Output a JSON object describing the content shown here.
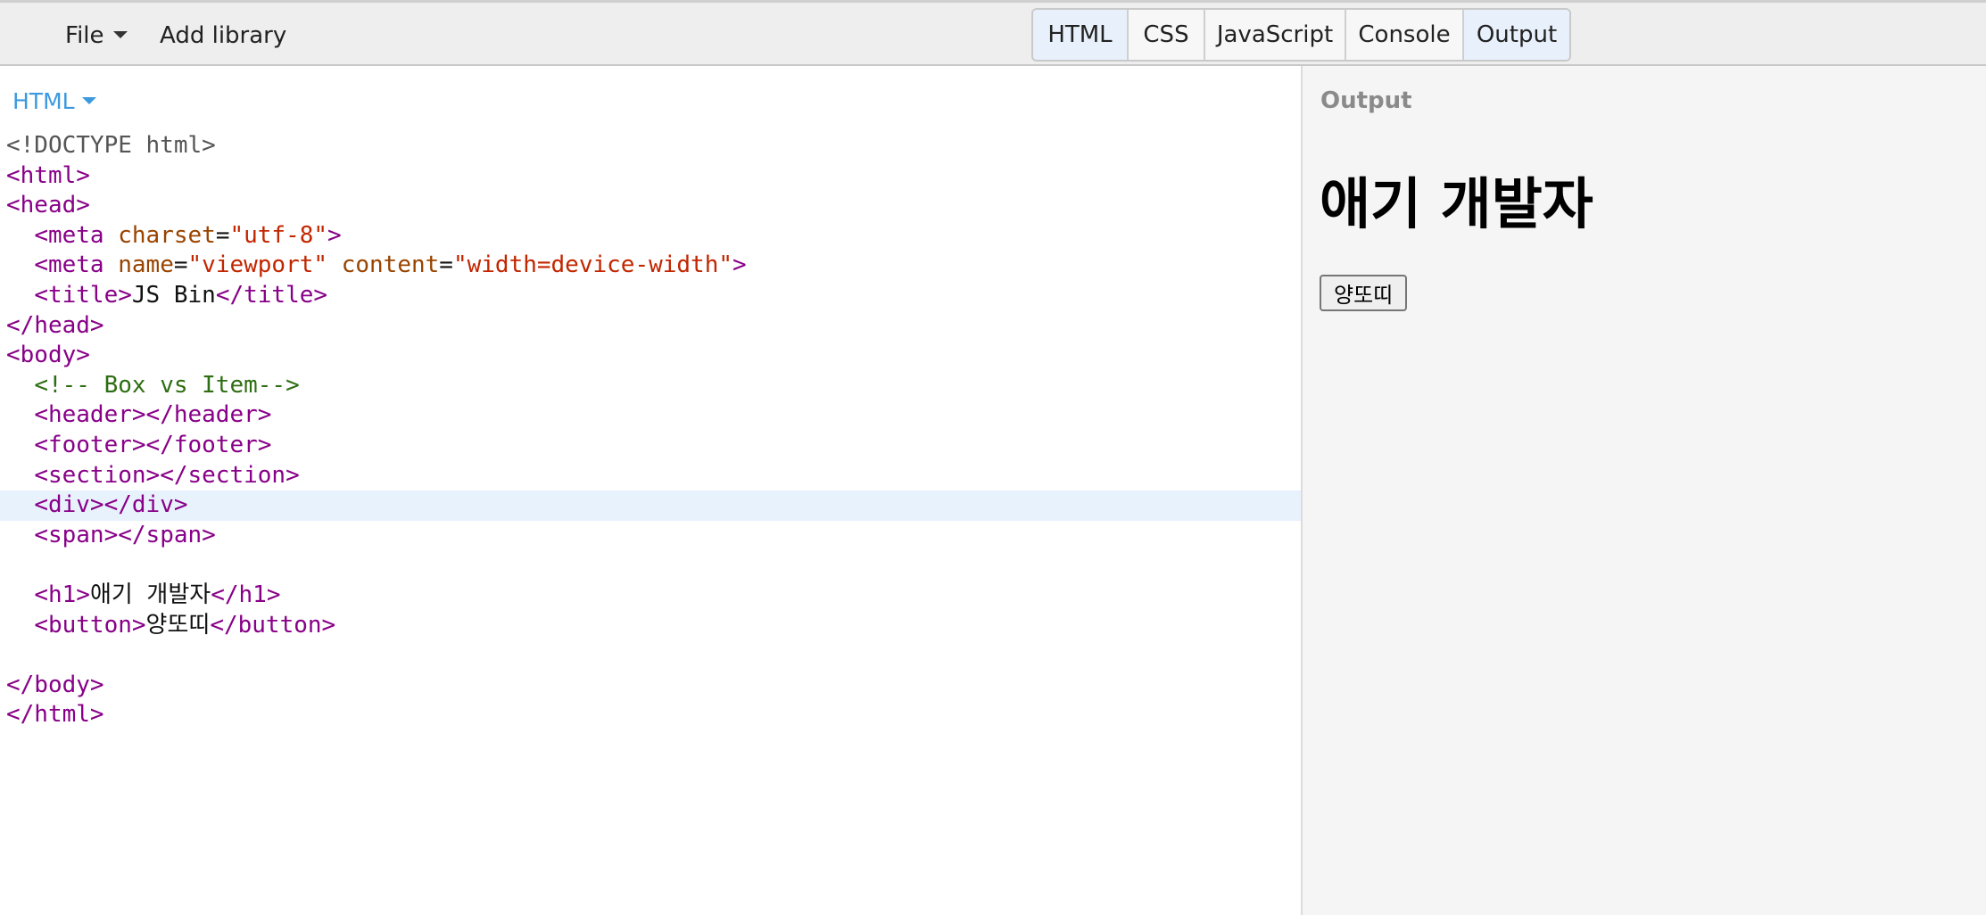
{
  "menu": {
    "file": "File",
    "add_library": "Add library"
  },
  "tabs": [
    {
      "label": "HTML",
      "active": true
    },
    {
      "label": "CSS",
      "active": false
    },
    {
      "label": "JavaScript",
      "active": false
    },
    {
      "label": "Console",
      "active": false
    },
    {
      "label": "Output",
      "active": true
    }
  ],
  "editor": {
    "panel_label": "HTML",
    "highlighted_line": 13,
    "lines": [
      {
        "segments": [
          {
            "cls": "t-doctype",
            "text": "<!DOCTYPE html>"
          }
        ]
      },
      {
        "segments": [
          {
            "cls": "t-tag",
            "text": "<html>"
          }
        ]
      },
      {
        "segments": [
          {
            "cls": "t-tag",
            "text": "<head>"
          }
        ]
      },
      {
        "segments": [
          {
            "cls": "t-text",
            "text": "  "
          },
          {
            "cls": "t-tag",
            "text": "<meta "
          },
          {
            "cls": "t-attr",
            "text": "charset"
          },
          {
            "cls": "t-text",
            "text": "="
          },
          {
            "cls": "t-str",
            "text": "\"utf-8\""
          },
          {
            "cls": "t-tag",
            "text": ">"
          }
        ]
      },
      {
        "segments": [
          {
            "cls": "t-text",
            "text": "  "
          },
          {
            "cls": "t-tag",
            "text": "<meta "
          },
          {
            "cls": "t-attr",
            "text": "name"
          },
          {
            "cls": "t-text",
            "text": "="
          },
          {
            "cls": "t-str",
            "text": "\"viewport\""
          },
          {
            "cls": "t-text",
            "text": " "
          },
          {
            "cls": "t-attr",
            "text": "content"
          },
          {
            "cls": "t-text",
            "text": "="
          },
          {
            "cls": "t-str",
            "text": "\"width=device-width\""
          },
          {
            "cls": "t-tag",
            "text": ">"
          }
        ]
      },
      {
        "segments": [
          {
            "cls": "t-text",
            "text": "  "
          },
          {
            "cls": "t-tag",
            "text": "<title>"
          },
          {
            "cls": "t-text",
            "text": "JS Bin"
          },
          {
            "cls": "t-tag",
            "text": "</title>"
          }
        ]
      },
      {
        "segments": [
          {
            "cls": "t-tag",
            "text": "</head>"
          }
        ]
      },
      {
        "segments": [
          {
            "cls": "t-tag",
            "text": "<body>"
          }
        ]
      },
      {
        "segments": [
          {
            "cls": "t-text",
            "text": "  "
          },
          {
            "cls": "t-comment",
            "text": "<!-- Box vs Item-->"
          }
        ]
      },
      {
        "segments": [
          {
            "cls": "t-text",
            "text": "  "
          },
          {
            "cls": "t-tag",
            "text": "<header></header>"
          }
        ]
      },
      {
        "segments": [
          {
            "cls": "t-text",
            "text": "  "
          },
          {
            "cls": "t-tag",
            "text": "<footer></footer>"
          }
        ]
      },
      {
        "segments": [
          {
            "cls": "t-text",
            "text": "  "
          },
          {
            "cls": "t-tag",
            "text": "<section></section>"
          }
        ]
      },
      {
        "segments": [
          {
            "cls": "t-text",
            "text": "  "
          },
          {
            "cls": "t-tag",
            "text": "<div></div>"
          }
        ]
      },
      {
        "segments": [
          {
            "cls": "t-text",
            "text": "  "
          },
          {
            "cls": "t-tag",
            "text": "<span></span>"
          }
        ]
      },
      {
        "segments": []
      },
      {
        "segments": [
          {
            "cls": "t-text",
            "text": "  "
          },
          {
            "cls": "t-tag",
            "text": "<h1>"
          },
          {
            "cls": "t-text",
            "text": "애기 개발자"
          },
          {
            "cls": "t-tag",
            "text": "</h1>"
          }
        ]
      },
      {
        "segments": [
          {
            "cls": "t-text",
            "text": "  "
          },
          {
            "cls": "t-tag",
            "text": "<button>"
          },
          {
            "cls": "t-text",
            "text": "양또띠"
          },
          {
            "cls": "t-tag",
            "text": "</button>"
          }
        ]
      },
      {
        "segments": []
      },
      {
        "segments": [
          {
            "cls": "t-tag",
            "text": "</body>"
          }
        ]
      },
      {
        "segments": [
          {
            "cls": "t-tag",
            "text": "</html>"
          }
        ]
      }
    ]
  },
  "output": {
    "label": "Output",
    "heading": "애기 개발자",
    "button_label": "양또띠"
  }
}
